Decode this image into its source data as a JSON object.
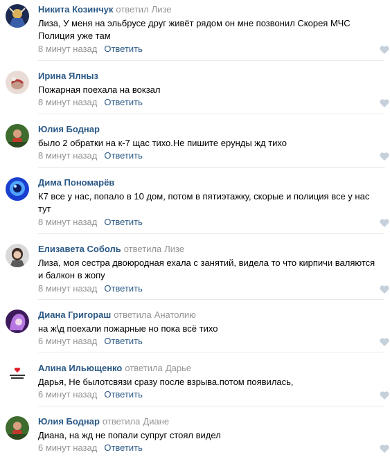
{
  "colors": {
    "author": "#2a5885",
    "muted": "#939393",
    "text": "#000000",
    "like": "#c5d0db"
  },
  "comments": [
    {
      "author": "Никита Козинчук",
      "replied": "ответил",
      "reply_to": "Лизе",
      "text": "Лиза, У меня на эльбрусе друг живёт рядом он мне позвонил Скорея МЧС Полиция уже там",
      "time": "8 минут назад",
      "reply_label": "Ответить",
      "like_icon": "heart-icon"
    },
    {
      "author": "Ирина Ялныз",
      "replied": "",
      "reply_to": "",
      "text": "Пожарная поехала на вокзал",
      "time": "8 минут назад",
      "reply_label": "Ответить",
      "like_icon": "heart-icon"
    },
    {
      "author": "Юлия Боднар",
      "replied": "",
      "reply_to": "",
      "text": "было 2 обратки на к-7 щас тихо.Не пишите ерунды жд тихо",
      "time": "8 минут назад",
      "reply_label": "Ответить",
      "like_icon": "heart-icon"
    },
    {
      "author": "Дима Пономарёв",
      "replied": "",
      "reply_to": "",
      "text": "К7 все у нас, попало в 10 дом, потом в пятиэтажку, скорые и полиция все у нас тут",
      "time": "8 минут назад",
      "reply_label": "Ответить",
      "like_icon": "heart-icon"
    },
    {
      "author": "Елизавета Соболь",
      "replied": "ответила",
      "reply_to": "Лизе",
      "text": "Лиза, моя сестра двоюродная ехала с занятий, видела то что кирпичи валяются и балкон в жопу",
      "time": "8 минут назад",
      "reply_label": "Ответить",
      "like_icon": "heart-icon"
    },
    {
      "author": "Диана Григораш",
      "replied": "ответила",
      "reply_to": "Анатолию",
      "text": "на ж\\д поехали пожарные но пока всё тихо",
      "time": "6 минут назад",
      "reply_label": "Ответить",
      "like_icon": "heart-icon"
    },
    {
      "author": "Алина Ильющенко",
      "replied": "ответила",
      "reply_to": "Дарье",
      "text": "Дарья, Не былотсвязи сразу после взрыва.потом появилась,",
      "time": "6 минут назад",
      "reply_label": "Ответить",
      "like_icon": "heart-icon"
    },
    {
      "author": "Юлия Боднар",
      "replied": "ответила",
      "reply_to": "Диане",
      "text": "Диана, на жд не попали супруг стоял видел",
      "time": "6 минут назад",
      "reply_label": "Ответить",
      "like_icon": "heart-icon"
    }
  ]
}
